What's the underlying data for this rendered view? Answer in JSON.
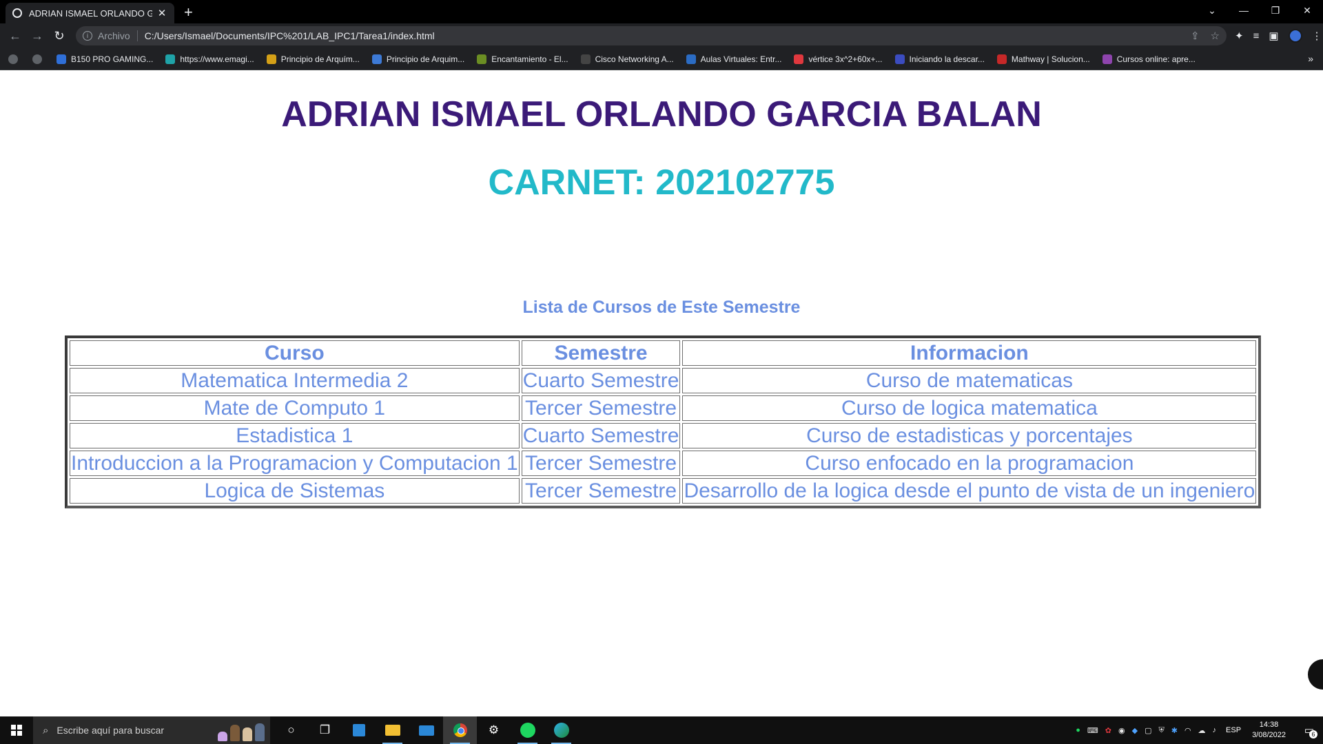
{
  "browser": {
    "tab_title": "ADRIAN ISMAEL ORLANDO GAR",
    "new_tab": "+",
    "window": {
      "minimize": "—",
      "restore": "❐",
      "close": "✕",
      "tab_search": "⌄"
    },
    "omnibox": {
      "scheme_label": "Archivo",
      "url": "C:/Users/Ismael/Documents/IPC%201/LAB_IPC1/Tarea1/index.html"
    },
    "bookmarks": [
      {
        "label": "",
        "icon": "grey-circle",
        "color": "#5f6368"
      },
      {
        "label": "",
        "icon": "grey-circle",
        "color": "#5f6368"
      },
      {
        "label": "B150 PRO GAMING...",
        "icon": "asus-icon",
        "color": "#2f6fd8"
      },
      {
        "label": "https://www.emagi...",
        "icon": "emagister-icon",
        "color": "#1fa3a8"
      },
      {
        "label": "Principio de Arquím...",
        "icon": "bulb-icon",
        "color": "#d4a017"
      },
      {
        "label": "Principio de Arquim...",
        "icon": "phi-icon",
        "color": "#3d7ad6"
      },
      {
        "label": "Encantamiento - El...",
        "icon": "cube-icon",
        "color": "#6b8e23"
      },
      {
        "label": "Cisco Networking A...",
        "icon": "cisco-icon",
        "color": "#444444"
      },
      {
        "label": "Aulas Virtuales: Entr...",
        "icon": "person-icon",
        "color": "#2b6cc4"
      },
      {
        "label": "vértice 3x^2+60x+...",
        "icon": "symbolab-icon",
        "color": "#e0383e"
      },
      {
        "label": "Iniciando la descar...",
        "icon": "download-icon",
        "color": "#3b4cc0"
      },
      {
        "label": "Mathway | Solucion...",
        "icon": "mathway-icon",
        "color": "#c62828"
      },
      {
        "label": "Cursos online: apre...",
        "icon": "udemy-icon",
        "color": "#8e44ad"
      }
    ],
    "bookmarks_overflow": "»"
  },
  "page": {
    "name_heading": "ADRIAN ISMAEL ORLANDO GARCIA BALAN",
    "carnet_heading": "CARNET: 202102775",
    "list_title": "Lista de Cursos de Este Semestre",
    "table": {
      "headers": [
        "Curso",
        "Semestre",
        "Informacion"
      ],
      "rows": [
        [
          "Matematica Intermedia 2",
          "Cuarto Semestre",
          "Curso de matematicas"
        ],
        [
          "Mate de Computo 1",
          "Tercer Semestre",
          "Curso de logica matematica"
        ],
        [
          "Estadistica 1",
          "Cuarto Semestre",
          "Curso de estadisticas y porcentajes"
        ],
        [
          "Introduccion a la Programacion y Computacion 1",
          "Tercer Semestre",
          "Curso enfocado en la programacion"
        ],
        [
          "Logica de Sistemas",
          "Tercer Semestre",
          "Desarrollo de la logica desde el punto de vista de un ingeniero"
        ]
      ]
    },
    "colors": {
      "name": "#3b1a78",
      "carnet": "#22b9c9",
      "table_text": "#6a8fe0"
    }
  },
  "taskbar": {
    "search_placeholder": "Escribe aquí para buscar",
    "language": "ESP",
    "time": "14:38",
    "date": "3/08/2022",
    "notification_count": "6"
  }
}
